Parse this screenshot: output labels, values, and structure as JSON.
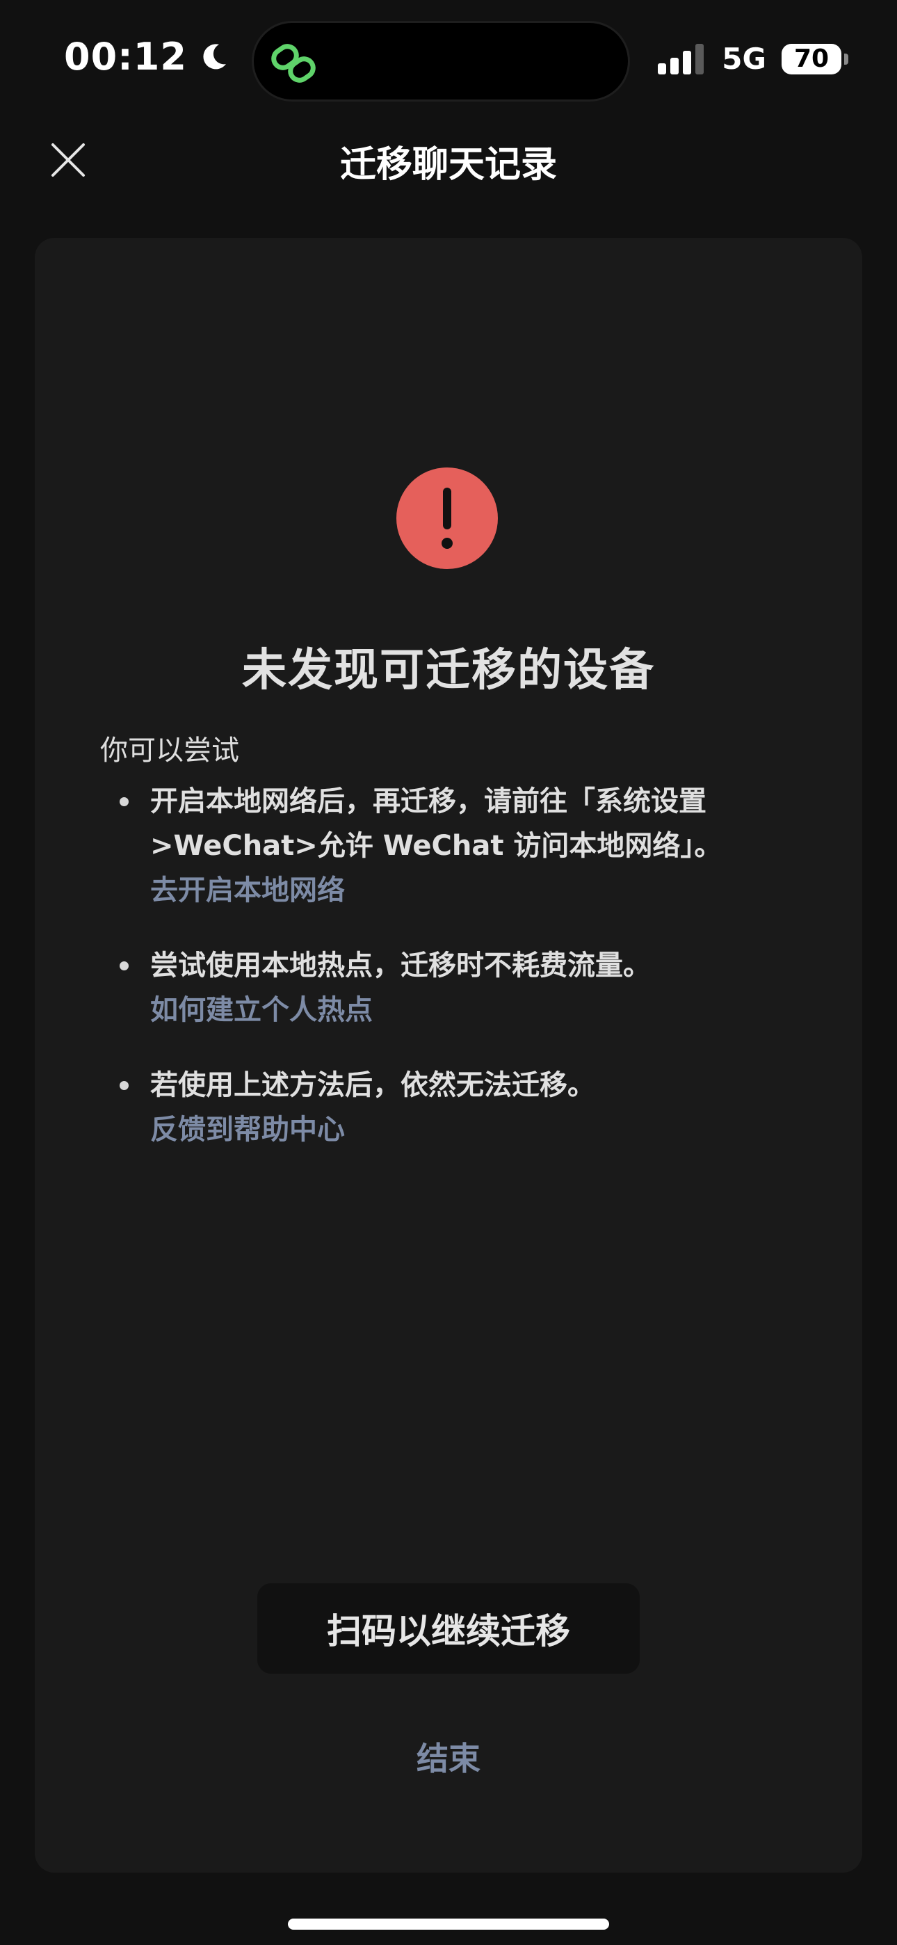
{
  "status_bar": {
    "time": "00:12",
    "network": "5G",
    "battery": "70"
  },
  "nav": {
    "title": "迁移聊天记录"
  },
  "main": {
    "headline": "未发现可迁移的设备",
    "try_label": "你可以尝试",
    "tips": [
      {
        "text": "开启本地网络后，再迁移，请前往「系统设置>WeChat>允许 WeChat 访问本地网络」。",
        "link": "去开启本地网络"
      },
      {
        "text": "尝试使用本地热点，迁移时不耗费流量。",
        "link": "如何建立个人热点"
      },
      {
        "text": "若使用上述方法后，依然无法迁移。",
        "link": "反馈到帮助中心"
      }
    ],
    "scan_button": "扫码以继续迁移",
    "end_link": "结束"
  },
  "colors": {
    "background": "#111111",
    "card": "#1a1a1a",
    "alert": "#e5605b",
    "link": "#7d8ba6",
    "island_icon": "#5fd36a"
  },
  "icons": [
    "moon-icon",
    "link-icon",
    "signal-icon",
    "battery-icon",
    "close-icon",
    "alert-icon"
  ]
}
